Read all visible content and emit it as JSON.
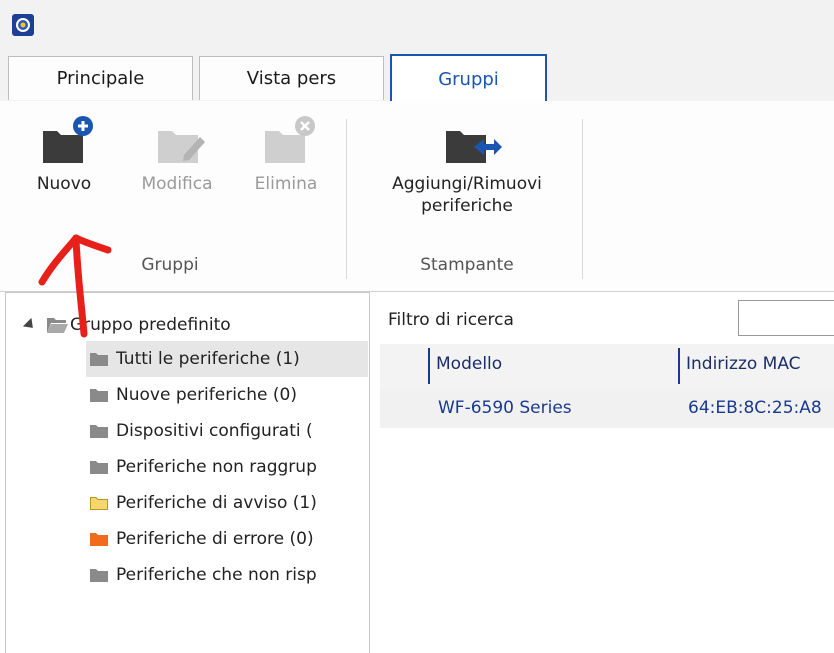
{
  "tabs": [
    {
      "label": "Principale",
      "active": false
    },
    {
      "label": "Vista pers",
      "active": false
    },
    {
      "label": "Gruppi",
      "active": true
    }
  ],
  "ribbon": {
    "groups": [
      {
        "label": "Gruppi",
        "buttons": [
          {
            "label": "Nuovo",
            "icon": "folder-add-icon",
            "enabled": true
          },
          {
            "label": "Modifica",
            "icon": "folder-edit-icon",
            "enabled": false
          },
          {
            "label": "Elimina",
            "icon": "folder-delete-icon",
            "enabled": false
          }
        ]
      },
      {
        "label": "Stampante",
        "buttons": [
          {
            "label_line1": "Aggiungi/Rimuovi",
            "label_line2": "periferiche",
            "icon": "folder-transfer-icon",
            "enabled": true
          }
        ]
      }
    ]
  },
  "tree": {
    "root": "Gruppo predefinito",
    "items": [
      {
        "label": "Tutti le periferiche (1)",
        "folder_color": "#8a8a8a",
        "selected": true
      },
      {
        "label": "Nuove periferiche (0)",
        "folder_color": "#8a8a8a",
        "selected": false
      },
      {
        "label": "Dispositivi configurati (",
        "folder_color": "#8a8a8a",
        "selected": false
      },
      {
        "label": "Periferiche non raggrup",
        "folder_color": "#8a8a8a",
        "selected": false
      },
      {
        "label": "Periferiche di avviso (1)",
        "folder_color": "#f5d76e",
        "selected": false
      },
      {
        "label": "Periferiche di errore (0)",
        "folder_color": "#f26a1b",
        "selected": false
      },
      {
        "label": "Periferiche che non risp",
        "folder_color": "#8a8a8a",
        "selected": false
      }
    ]
  },
  "filter": {
    "label": "Filtro di ricerca",
    "value": ""
  },
  "grid": {
    "columns": [
      "Modello",
      "Indirizzo MAC"
    ],
    "rows": [
      {
        "model": "WF-6590 Series",
        "mac": "64:EB:8C:25:A8"
      }
    ]
  },
  "colors": {
    "accent": "#1a56b0",
    "warning_folder": "#f5d76e",
    "error_folder": "#f26a1b",
    "annotation": "#e8201a"
  }
}
